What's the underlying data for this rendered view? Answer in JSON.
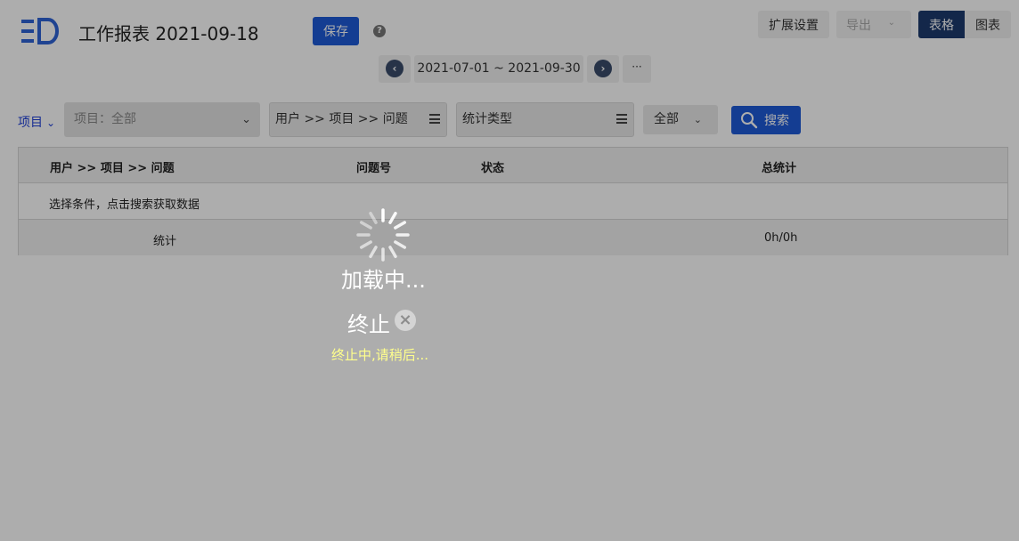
{
  "header": {
    "title": "工作报表 2021-09-18",
    "save_label": "保存",
    "help_glyph": "?",
    "ext_settings_label": "扩展设置",
    "export_label": "导出",
    "view_table_label": "表格",
    "view_chart_label": "图表"
  },
  "date_range": {
    "value": "2021-07-01 ~ 2021-09-30",
    "more_label": "···"
  },
  "filters": {
    "scope_label": "项目",
    "project_select": "项目：全部",
    "group_select": "用户 >> 项目 >> 问题",
    "type_select": "统计类型",
    "all_select": "全部",
    "search_label": "搜索"
  },
  "table": {
    "columns": [
      "用户 >> 项目 >> 问题",
      "问题号",
      "状态",
      "总统计"
    ],
    "empty_message": "选择条件，点击搜索获取数据",
    "total_label": "统计",
    "total_value": "0h/0h"
  },
  "loading": {
    "text": "加载中...",
    "stop_label": "终止",
    "stopping_text": "终止中,请稍后..."
  },
  "colors": {
    "primary": "#1e5ad8",
    "active_toggle": "#1d3a6e",
    "stopping_text": "#ffff8c"
  }
}
